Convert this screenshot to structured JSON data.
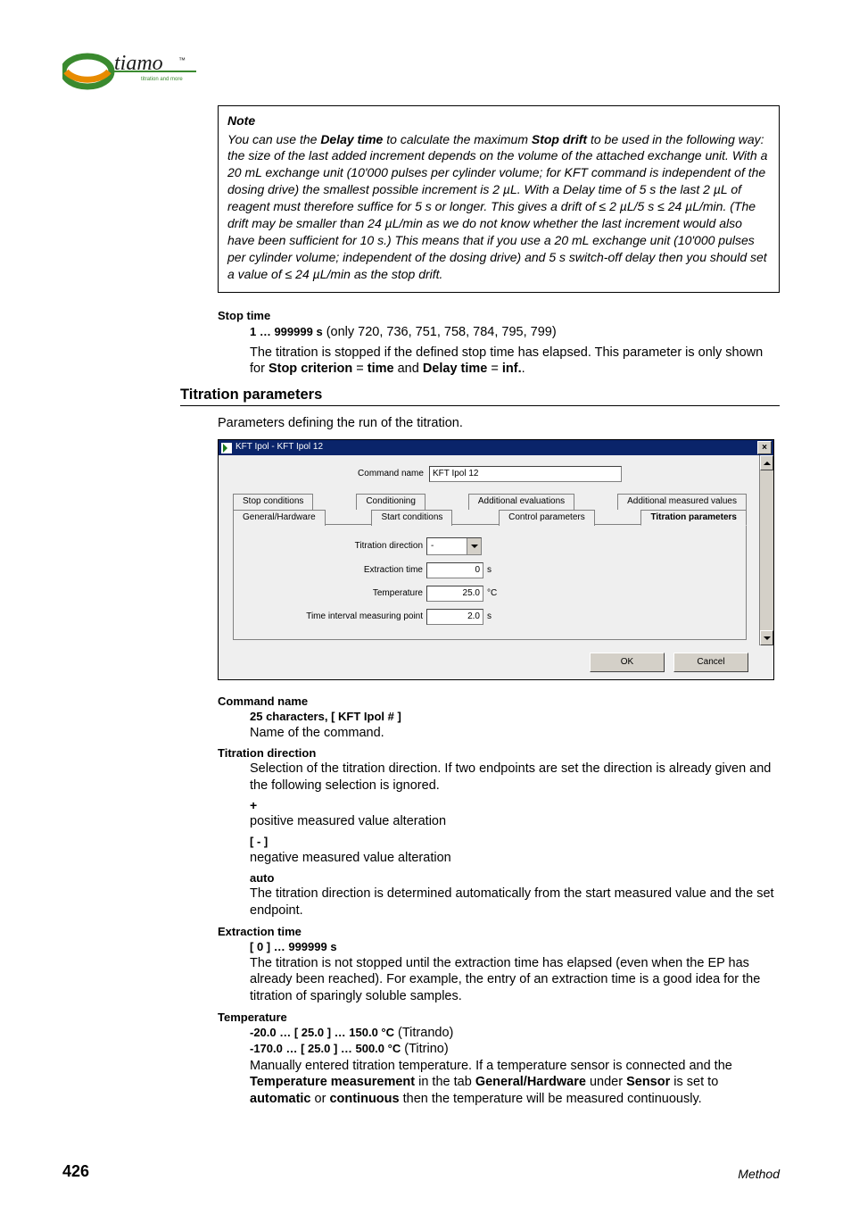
{
  "logo": {
    "brand": "tiamo",
    "tagline": "titration and more"
  },
  "note": {
    "title": "Note",
    "body_pre": "You can use the ",
    "kw1": "Delay time",
    "body_mid1": " to calculate the maximum ",
    "kw2": "Stop drift",
    "body_after": " to be used in the following way: the size of the last added increment depends on the volume of the attached exchange unit. With a 20 mL exchange unit (10'000 pulses per cylinder volume; for KFT command is independent of the dosing drive) the smallest possible increment is 2 µL. With a Delay time of 5 s the last 2 µL of reagent must therefore suffice for 5 s or longer. This gives a drift of ≤ 2 µL/5 s ≤ 24 µL/min. (The drift may be smaller than 24 µL/min as we do not know whether the last increment would also have been sufficient for 10 s.) This means that if you use a 20 mL exchange unit (10'000 pulses per cylinder volume; independent of the dosing drive) and 5 s switch-off delay then you should set a value of ≤ 24 µL/min as the stop drift."
  },
  "stop_time": {
    "term": "Stop time",
    "range": "1 … 999999 s",
    "range_note": " (only 720, 736, 751, 758, 784, 795, 799)",
    "desc_pre": "The titration is stopped if the defined stop time has elapsed. This parameter is only shown for ",
    "kw1": "Stop criterion",
    "eq1": " = ",
    "val1": "time",
    "mid": " and ",
    "kw2": "Delay time",
    "eq2": " = ",
    "val2": "inf.",
    "end": "."
  },
  "section": {
    "title": "Titration parameters",
    "intro": "Parameters defining the run of the titration."
  },
  "dialog": {
    "title": "KFT Ipol - KFT Ipol 12",
    "command_label": "Command name",
    "command_value": "KFT Ipol 12",
    "tabs_row1": [
      "Stop conditions",
      "Conditioning",
      "Additional evaluations",
      "Additional measured values"
    ],
    "tabs_row2": [
      "General/Hardware",
      "Start conditions",
      "Control parameters",
      "Titration parameters"
    ],
    "active_tab": "Titration parameters",
    "fields": {
      "titration_direction": {
        "label": "Titration direction",
        "value": "-"
      },
      "extraction_time": {
        "label": "Extraction time",
        "value": "0",
        "unit": "s"
      },
      "temperature": {
        "label": "Temperature",
        "value": "25.0",
        "unit": "°C"
      },
      "time_interval": {
        "label": "Time interval measuring point",
        "value": "2.0",
        "unit": "s"
      }
    },
    "buttons": {
      "ok": "OK",
      "cancel": "Cancel"
    }
  },
  "defs": {
    "command_name": {
      "term": "Command name",
      "range": "25 characters, [ KFT Ipol # ]",
      "desc": "Name of the command."
    },
    "titration_direction": {
      "term": "Titration direction",
      "desc": "Selection of the titration direction. If two endpoints are set the direction is already given and the following selection is ignored.",
      "plus": "+",
      "plus_desc": "positive measured value alteration",
      "minus": "[ - ]",
      "minus_desc": "negative measured value alteration",
      "auto": "auto",
      "auto_desc": "The titration direction is determined automatically from the start measured value and the set endpoint."
    },
    "extraction_time": {
      "term": "Extraction time",
      "range": "[ 0 ] … 999999 s",
      "desc": "The titration is not stopped until the extraction time has elapsed (even when the EP has already been reached). For example, the entry of an extraction time is a good idea for the titration of sparingly soluble samples."
    },
    "temperature": {
      "term": "Temperature",
      "range1": "-20.0 … [ 25.0 ] … 150.0 °C",
      "range1_note": " (Titrando)",
      "range2": "-170.0 … [ 25.0 ] … 500.0 °C",
      "range2_note": " (Titrino)",
      "desc_pre": "Manually entered titration temperature. If a temperature sensor is connected and the ",
      "kw1": "Temperature measurement",
      "mid1": " in the tab ",
      "kw2": "General/Hardware",
      "mid2": " under ",
      "kw3": "Sensor",
      "mid3": " is set to ",
      "kw4": "automatic",
      "mid4": " or ",
      "kw5": "continuous",
      "end": " then the temperature will be measured continuously."
    }
  },
  "footer": {
    "page": "426",
    "right": "Method"
  }
}
